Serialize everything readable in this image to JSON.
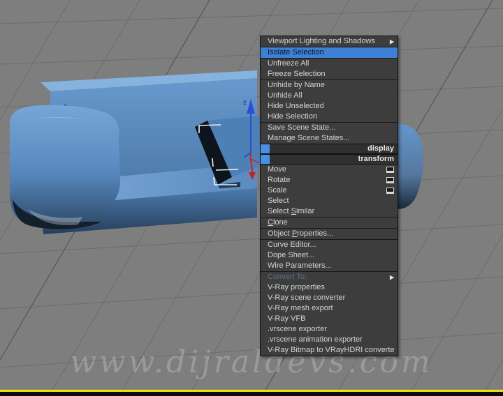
{
  "viewport": {
    "gizmo_axis_label": "z",
    "watermark": "www.dijraldevs.com"
  },
  "colors": {
    "viewport_bg": "#7e7e7e",
    "grid_line": "#6c6c6c",
    "grid_line_dark": "#4f4f4f",
    "menu_bg": "#3d3d3d",
    "menu_text": "#d4d4d4",
    "highlight_bg": "#3e80d3",
    "highlight_text": "#0b1322",
    "header_accent": "#4a8fe2",
    "disabled_text": "#5f7083",
    "couch_blue": "#5d8fc7",
    "gizmo_z": "#2a50d8",
    "gizmo_x": "#cc2020",
    "selection_bracket": "#f2f2f2",
    "timeline_yellow": "#f2e40e"
  },
  "context_menu": {
    "items": [
      {
        "type": "item",
        "label": "Viewport Lighting and Shadows",
        "submenu": true
      },
      {
        "type": "separator"
      },
      {
        "type": "item",
        "label": "Isolate Selection",
        "highlighted": true
      },
      {
        "type": "separator"
      },
      {
        "type": "item",
        "label": "Unfreeze All"
      },
      {
        "type": "item",
        "label": "Freeze Selection"
      },
      {
        "type": "separator"
      },
      {
        "type": "item",
        "label": "Unhide by Name"
      },
      {
        "type": "item",
        "label": "Unhide All"
      },
      {
        "type": "item",
        "label": "Hide Unselected"
      },
      {
        "type": "item",
        "label": "Hide Selection"
      },
      {
        "type": "separator"
      },
      {
        "type": "item",
        "label": "Save Scene State..."
      },
      {
        "type": "item",
        "label": "Manage Scene States..."
      },
      {
        "type": "header",
        "label": "display"
      },
      {
        "type": "header",
        "label": "transform"
      },
      {
        "type": "item",
        "label": "Move",
        "settings": true
      },
      {
        "type": "item",
        "label": "Rotate",
        "settings": true
      },
      {
        "type": "item",
        "label": "Scale",
        "settings": true
      },
      {
        "type": "item",
        "label": "Select"
      },
      {
        "type": "item",
        "label": "Select Similar",
        "u": 7
      },
      {
        "type": "separator"
      },
      {
        "type": "item",
        "label": "Clone",
        "u": 0
      },
      {
        "type": "separator"
      },
      {
        "type": "item",
        "label": "Object Properties...",
        "u": 7
      },
      {
        "type": "separator"
      },
      {
        "type": "item",
        "label": "Curve Editor..."
      },
      {
        "type": "item",
        "label": "Dope Sheet..."
      },
      {
        "type": "item",
        "label": "Wire Parameters..."
      },
      {
        "type": "separator"
      },
      {
        "type": "item",
        "label": "Convert To:",
        "disabled": true,
        "submenu": true
      },
      {
        "type": "item",
        "label": "V-Ray properties"
      },
      {
        "type": "item",
        "label": "V-Ray scene converter"
      },
      {
        "type": "item",
        "label": "V-Ray mesh export"
      },
      {
        "type": "item",
        "label": "V-Ray VFB"
      },
      {
        "type": "item",
        "label": ".vrscene exporter"
      },
      {
        "type": "item",
        "label": ".vrscene animation exporter"
      },
      {
        "type": "item",
        "label": "V-Ray Bitmap to VRayHDRI converter"
      }
    ]
  }
}
